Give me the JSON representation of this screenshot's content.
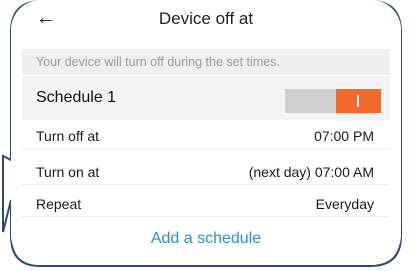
{
  "header": {
    "title": "Device off at",
    "back_icon": "arrow-left-icon"
  },
  "banner": {
    "text": "Your device will turn off during the set times."
  },
  "schedule": {
    "label": "Schedule 1",
    "enabled": true,
    "accent": "#f26a2e"
  },
  "details": [
    {
      "key": "Turn off at",
      "value": "07:00 PM"
    },
    {
      "key": "Turn on at",
      "value": "(next day) 07:00 AM"
    },
    {
      "key": "Repeat",
      "value": "Everyday"
    }
  ],
  "actions": {
    "add_label": "Add a schedule",
    "link_color": "#2e8fd1"
  }
}
